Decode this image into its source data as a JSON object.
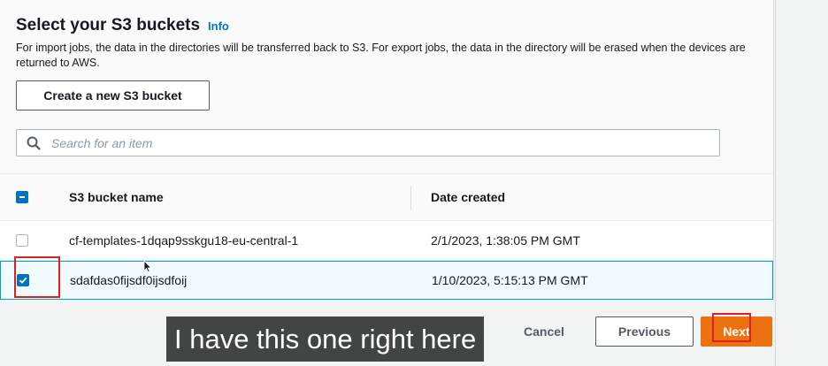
{
  "section": {
    "title": "Select your S3 buckets",
    "info_link": "Info",
    "description": "For import jobs, the data in the directories will be transferred back to S3. For export jobs, the data in the directory will be erased when the devices are returned to AWS.",
    "create_button": "Create a new S3 bucket"
  },
  "search": {
    "placeholder": "Search for an item",
    "value": ""
  },
  "table": {
    "headers": {
      "name": "S3 bucket name",
      "date": "Date created"
    },
    "header_checkbox_state": "indeterminate",
    "rows": [
      {
        "name": "cf-templates-1dqap9sskgu18-eu-central-1",
        "date": "2/1/2023, 1:38:05 PM GMT",
        "selected": false
      },
      {
        "name": "sdafdas0fijsdf0ijsdfoij",
        "date": "1/10/2023, 5:15:13 PM GMT",
        "selected": true
      }
    ]
  },
  "footer": {
    "cancel_label": "Cancel",
    "previous_label": "Previous",
    "next_label": "Next"
  },
  "caption": "I have this one right here",
  "colors": {
    "accent_blue": "#0073bb",
    "primary_orange": "#ec7211",
    "highlight_red": "#e02020",
    "selected_row_border": "#00a1c9"
  },
  "icons": {
    "search": "search-icon",
    "checkbox_checked": "checkbox-checked-icon",
    "checkbox_indeterminate": "checkbox-indeterminate-icon",
    "cursor": "mouse-cursor-icon"
  }
}
